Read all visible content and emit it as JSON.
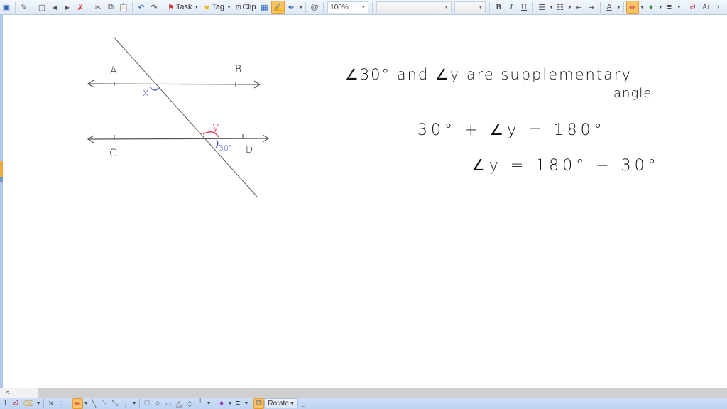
{
  "toolbar": {
    "task_label": "Task",
    "tag_label": "Tag",
    "clip_label": "Clip",
    "zoom_value": "100%",
    "font_name_value": "",
    "font_size_value": "",
    "bold_label": "B",
    "italic_label": "I",
    "underline_label": "U",
    "font_color_label": "A",
    "superscript_label": "A",
    "icons": [
      "select-icon",
      "new-page-icon",
      "back-icon",
      "forward-icon",
      "delete-page-icon",
      "cut-icon",
      "copy-icon",
      "paste-icon",
      "undo-icon",
      "redo-icon",
      "task-flag-icon",
      "tag-star-icon",
      "clip-icon",
      "table-icon",
      "pen-mode-icon",
      "highlighter-icon",
      "at-icon",
      "bullets-icon",
      "numbering-icon",
      "decrease-indent-icon",
      "increase-indent-icon",
      "pen-color-icon",
      "fill-color-icon",
      "line-style-icon",
      "lasso-icon",
      "superscript-icon",
      "more-icon"
    ]
  },
  "bottom_toolbar": {
    "rotate_label": "Rotate",
    "scroll_left": "<",
    "icons": [
      "type-icon",
      "lasso-icon",
      "eraser-icon",
      "delete-icon",
      "insert-space-icon",
      "pen-icon",
      "line-icon",
      "arrow-line-icon",
      "double-arrow-icon",
      "connector-icon",
      "rectangle-icon",
      "ellipse-icon",
      "parallelogram-icon",
      "triangle-icon",
      "diamond-icon",
      "axis-icon",
      "color-wheel-icon",
      "line-weight-icon",
      "arrange-icon"
    ]
  },
  "diagram": {
    "labels": {
      "A": "A",
      "B": "B",
      "C": "C",
      "D": "D",
      "x": "x",
      "y": "y",
      "angle_30": "30°"
    },
    "colors": {
      "line": "#555555",
      "x_mark": "#4a4ad0",
      "y_mark": "#e0304a",
      "angle_30_mark": "#4a4ad0"
    }
  },
  "notes": {
    "line1": "∠30°   and   ∠y   are   supplementary",
    "line1b": "angle",
    "line2": "30° + ∠y = 180°",
    "line3": "∠y = 180° − 30°"
  }
}
